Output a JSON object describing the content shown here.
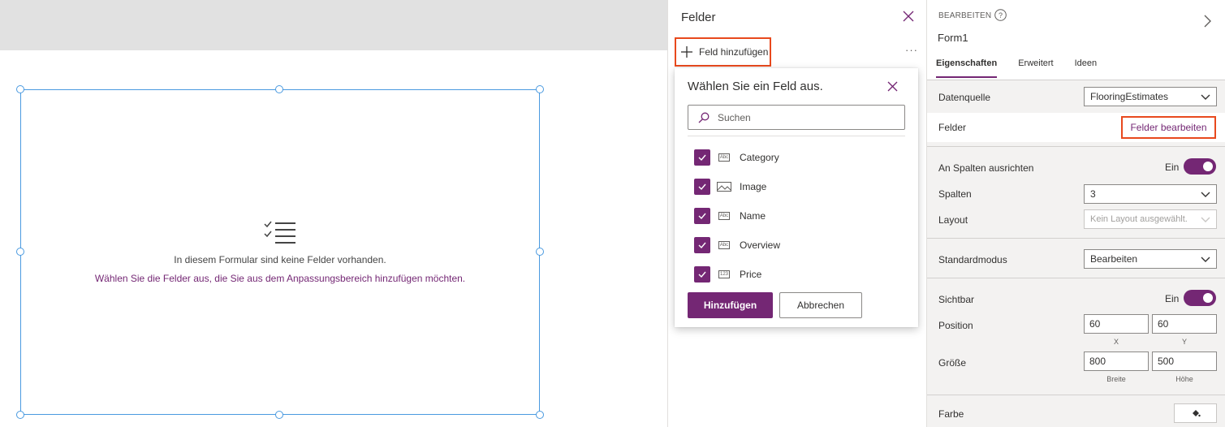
{
  "canvas": {
    "empty_message": "In diesem Formular sind keine Felder vorhanden.",
    "empty_link": "Wählen Sie die Felder aus, die Sie aus dem Anpassungsbereich hinzufügen möchten."
  },
  "fields_pane": {
    "title": "Felder",
    "add_field_label": "Feld hinzufügen",
    "more_label": "···"
  },
  "picker": {
    "title": "Wählen Sie ein Feld aus.",
    "search_placeholder": "Suchen",
    "items": [
      {
        "name": "Category",
        "type": "Abc",
        "checked": true
      },
      {
        "name": "Image",
        "type": "image-icon",
        "checked": true
      },
      {
        "name": "Name",
        "type": "Abc",
        "checked": true
      },
      {
        "name": "Overview",
        "type": "Abc",
        "checked": true
      },
      {
        "name": "Price",
        "type": "123",
        "checked": true
      }
    ],
    "add_button": "Hinzufügen",
    "cancel_button": "Abbrechen"
  },
  "properties": {
    "edit_label": "BEARBEITEN",
    "control_name": "Form1",
    "tabs": [
      "Eigenschaften",
      "Erweitert",
      "Ideen"
    ],
    "active_tab": "Eigenschaften",
    "datasource_label": "Datenquelle",
    "datasource_value": "FlooringEstimates",
    "fields_label": "Felder",
    "edit_fields_link": "Felder bearbeiten",
    "snap_label": "An Spalten ausrichten",
    "snap_value": "Ein",
    "columns_label": "Spalten",
    "columns_value": "3",
    "layout_label": "Layout",
    "layout_value": "Kein Layout ausgewählt.",
    "default_mode_label": "Standardmodus",
    "default_mode_value": "Bearbeiten",
    "visible_label": "Sichtbar",
    "visible_value": "Ein",
    "position_label": "Position",
    "position_x": "60",
    "position_y": "60",
    "x_label": "X",
    "y_label": "Y",
    "size_label": "Größe",
    "width_value": "800",
    "height_value": "500",
    "width_label": "Breite",
    "height_label": "Höhe",
    "color_label": "Farbe"
  },
  "colors": {
    "accent": "#742774",
    "highlight_border": "#e8491d",
    "selection": "#4a9ae0"
  }
}
